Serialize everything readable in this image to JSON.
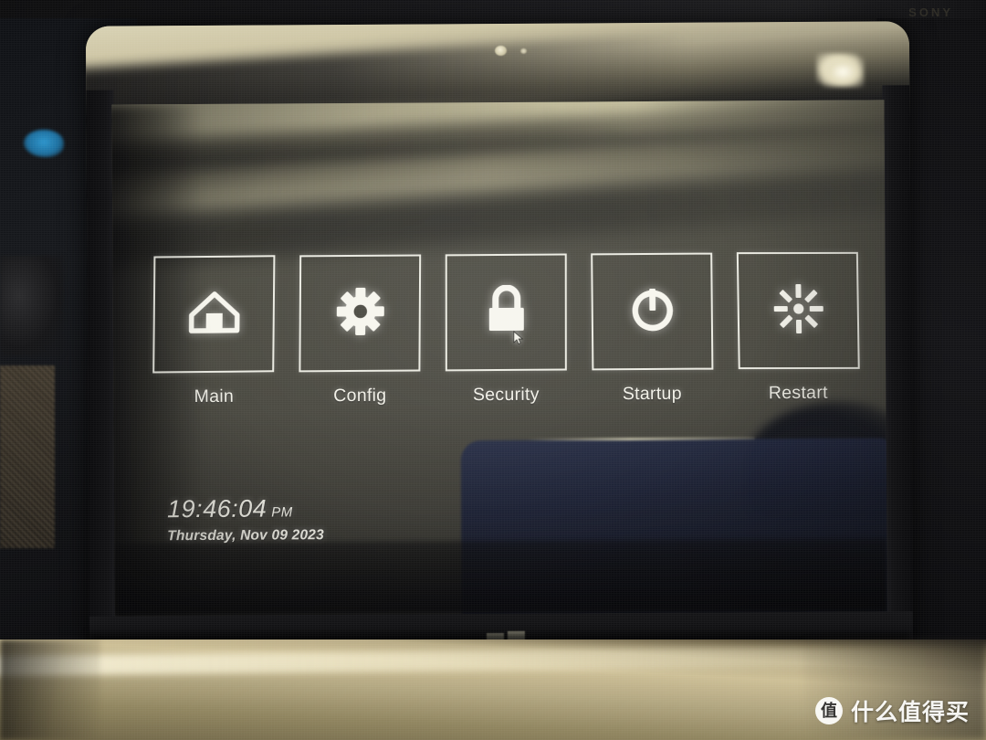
{
  "device": {
    "type": "tablet",
    "background_logo": "SONY",
    "bezel": {
      "camera_icon": "camera-dot",
      "sensor_icon": "sensor-dot",
      "home_button_icon": "windows-logo-icon"
    }
  },
  "bios": {
    "screen_title": "",
    "tiles": [
      {
        "label": "Main",
        "icon": "home-icon",
        "selected": false
      },
      {
        "label": "Config",
        "icon": "gear-icon",
        "selected": false
      },
      {
        "label": "Security",
        "icon": "lock-icon",
        "selected": true
      },
      {
        "label": "Startup",
        "icon": "power-icon",
        "selected": false
      },
      {
        "label": "Restart",
        "icon": "restart-icon",
        "selected": false
      }
    ],
    "clock": {
      "time": "19:46:04",
      "meridiem": "PM",
      "date": "Thursday, Nov 09 2023"
    },
    "cursor": {
      "icon": "mouse-pointer-icon",
      "on_tile": "Security"
    }
  },
  "watermark": {
    "badge": "值",
    "text": "什么值得买"
  },
  "colors": {
    "screen_bg": "#4a4941",
    "tile_border": "#f8f8f0",
    "text": "#f2f1e8",
    "desk": "#cdbf96",
    "bezel": "#0d0d0f"
  }
}
